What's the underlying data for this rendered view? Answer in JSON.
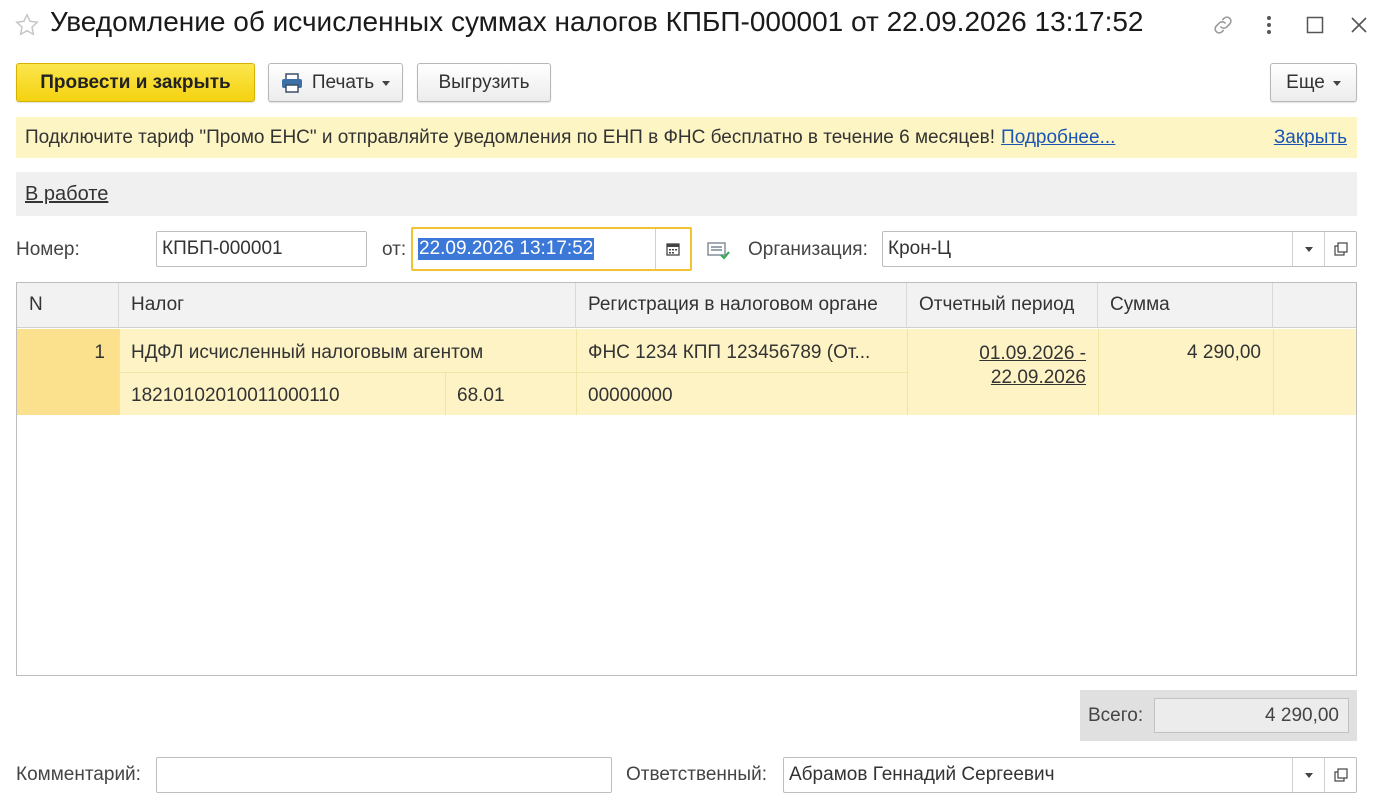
{
  "window": {
    "title": "Уведомление об исчисленных суммах налогов КПБП-000001 от 22.09.2026 13:17:52",
    "icons": [
      "star-icon",
      "link-icon",
      "more-vertical-icon",
      "maximize-icon",
      "close-icon"
    ]
  },
  "toolbar": {
    "post_close": "Провести и закрыть",
    "print": "Печать",
    "export": "Выгрузить",
    "more": "Еще"
  },
  "banner": {
    "text": "Подключите тариф \"Промо ЕНС\" и отправляйте уведомления по ЕНП в ФНС бесплатно в течение 6 месяцев!",
    "more_link": "Подробнее...",
    "close_link": "Закрыть"
  },
  "status": {
    "label": "В работе"
  },
  "form": {
    "number_label": "Номер:",
    "number_value": "КПБП-000001",
    "date_label": "от:",
    "date_value": "22.09.2026 13:17:52",
    "org_label": "Организация:",
    "org_value": "Крон-Ц"
  },
  "table": {
    "headers": [
      "N",
      "Налог",
      "Регистрация в налоговом органе",
      "Отчетный период",
      "Сумма"
    ],
    "rows": [
      {
        "n": "1",
        "tax": "НДФЛ исчисленный налоговым агентом",
        "kbk": "18210102010011000110",
        "account": "68.01",
        "registration": "ФНС 1234 КПП 123456789 (От...",
        "oktmo": "00000000",
        "period_line1": "01.09.2026 -",
        "period_line2": "22.09.2026",
        "sum": "4 290,00"
      }
    ]
  },
  "totals": {
    "label": "Всего:",
    "value": "4 290,00"
  },
  "footer": {
    "comment_label": "Комментарий:",
    "comment_value": "",
    "responsible_label": "Ответственный:",
    "responsible_value": "Абрамов Геннадий Сергеевич"
  },
  "colors": {
    "accent_yellow": "#f4d210",
    "banner_bg": "#fdf6c4",
    "row_selected": "#fdf3c5",
    "link": "#1a55b5",
    "selection": "#3b78d8"
  }
}
